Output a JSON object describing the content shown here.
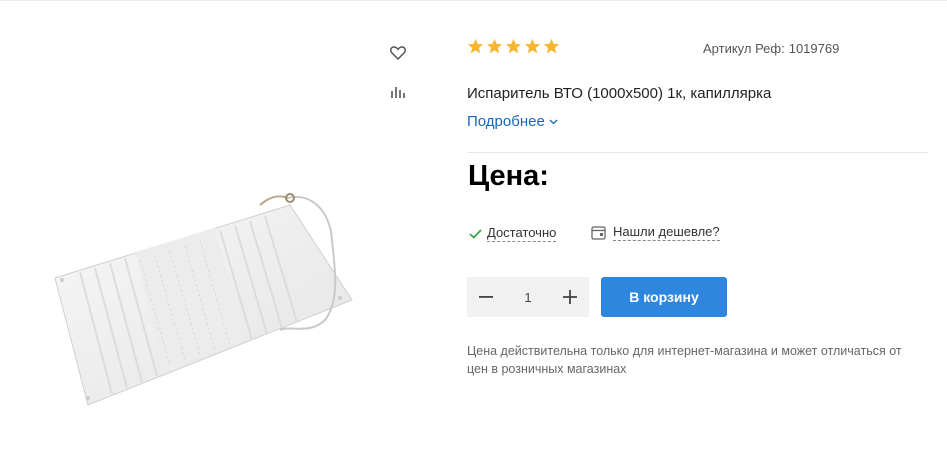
{
  "product": {
    "rating": {
      "value": 5,
      "max": 5,
      "color": "#f5b631"
    },
    "article_label": "Артикул Реф:",
    "article_value": "1019769",
    "title": "Испаритель ВТО (1000x500) 1к, капиллярка",
    "more_label": "Подробнее",
    "price_label": "Цена:",
    "stock_label": "Достаточно",
    "cheaper_label": "Нашли дешевле?",
    "quantity": "1",
    "cart_label": "В корзину",
    "note": "Цена действительна только для интернет-магазина и может отличаться от цен в розничных магазинах"
  },
  "colors": {
    "accent": "#2e86de",
    "link": "#1a66b8",
    "in_stock": "#3aa24a"
  },
  "icons": {
    "favorite": "heart-icon",
    "compare": "bar-chart-icon",
    "more": "chevron-down-icon",
    "stock": "checkmark-icon",
    "cheaper": "tag-icon",
    "decrease": "minus-icon",
    "increase": "plus-icon"
  }
}
